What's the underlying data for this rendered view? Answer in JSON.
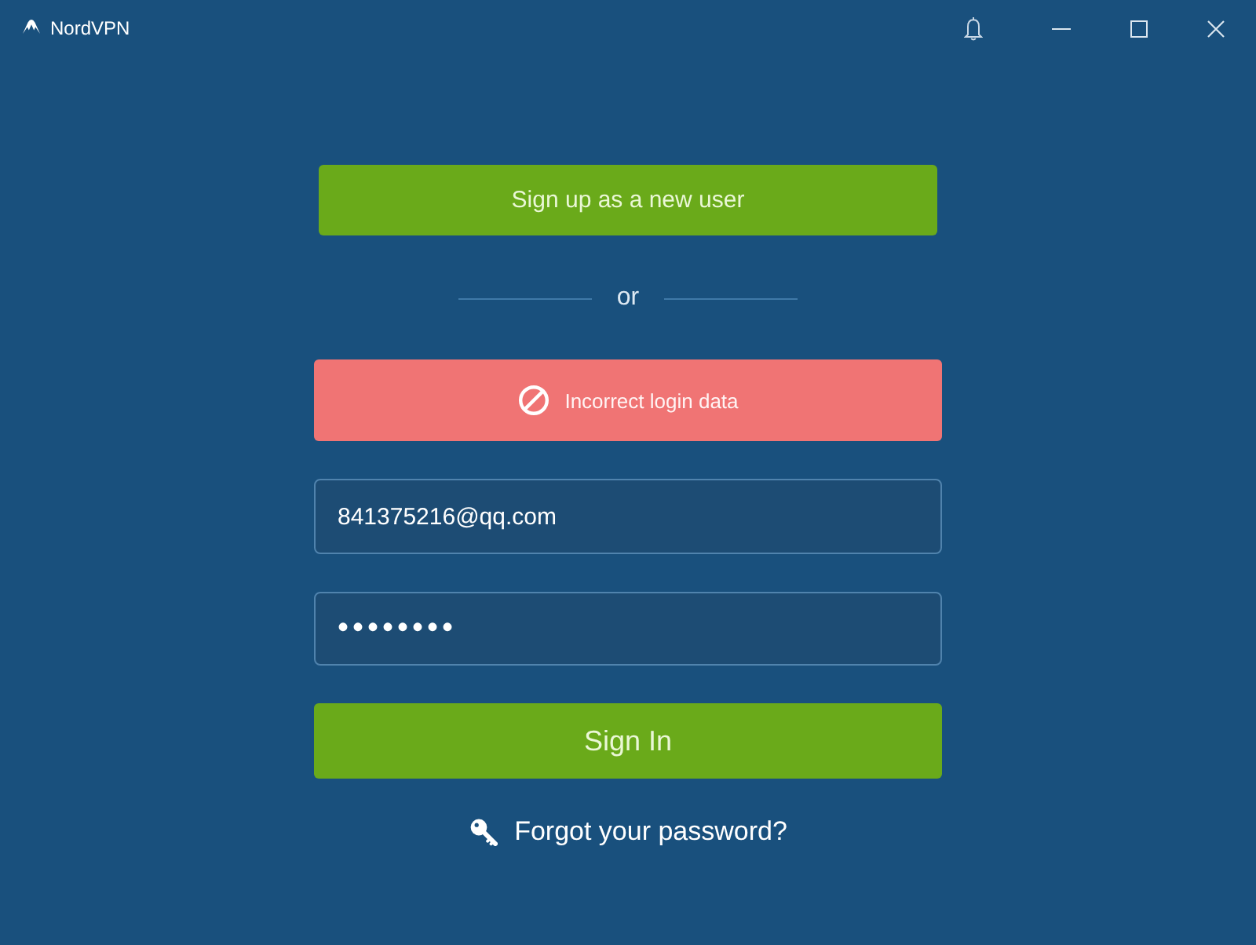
{
  "window": {
    "title": "NordVPN"
  },
  "signup_button": {
    "label": "Sign up as a new user"
  },
  "divider": {
    "label": "or"
  },
  "error_banner": {
    "message": "Incorrect login data"
  },
  "email_field": {
    "value": "841375216@qq.com"
  },
  "password_field": {
    "value": "••••••••"
  },
  "signin_button": {
    "label": "Sign In"
  },
  "forgot_link": {
    "label": "Forgot your password?"
  }
}
